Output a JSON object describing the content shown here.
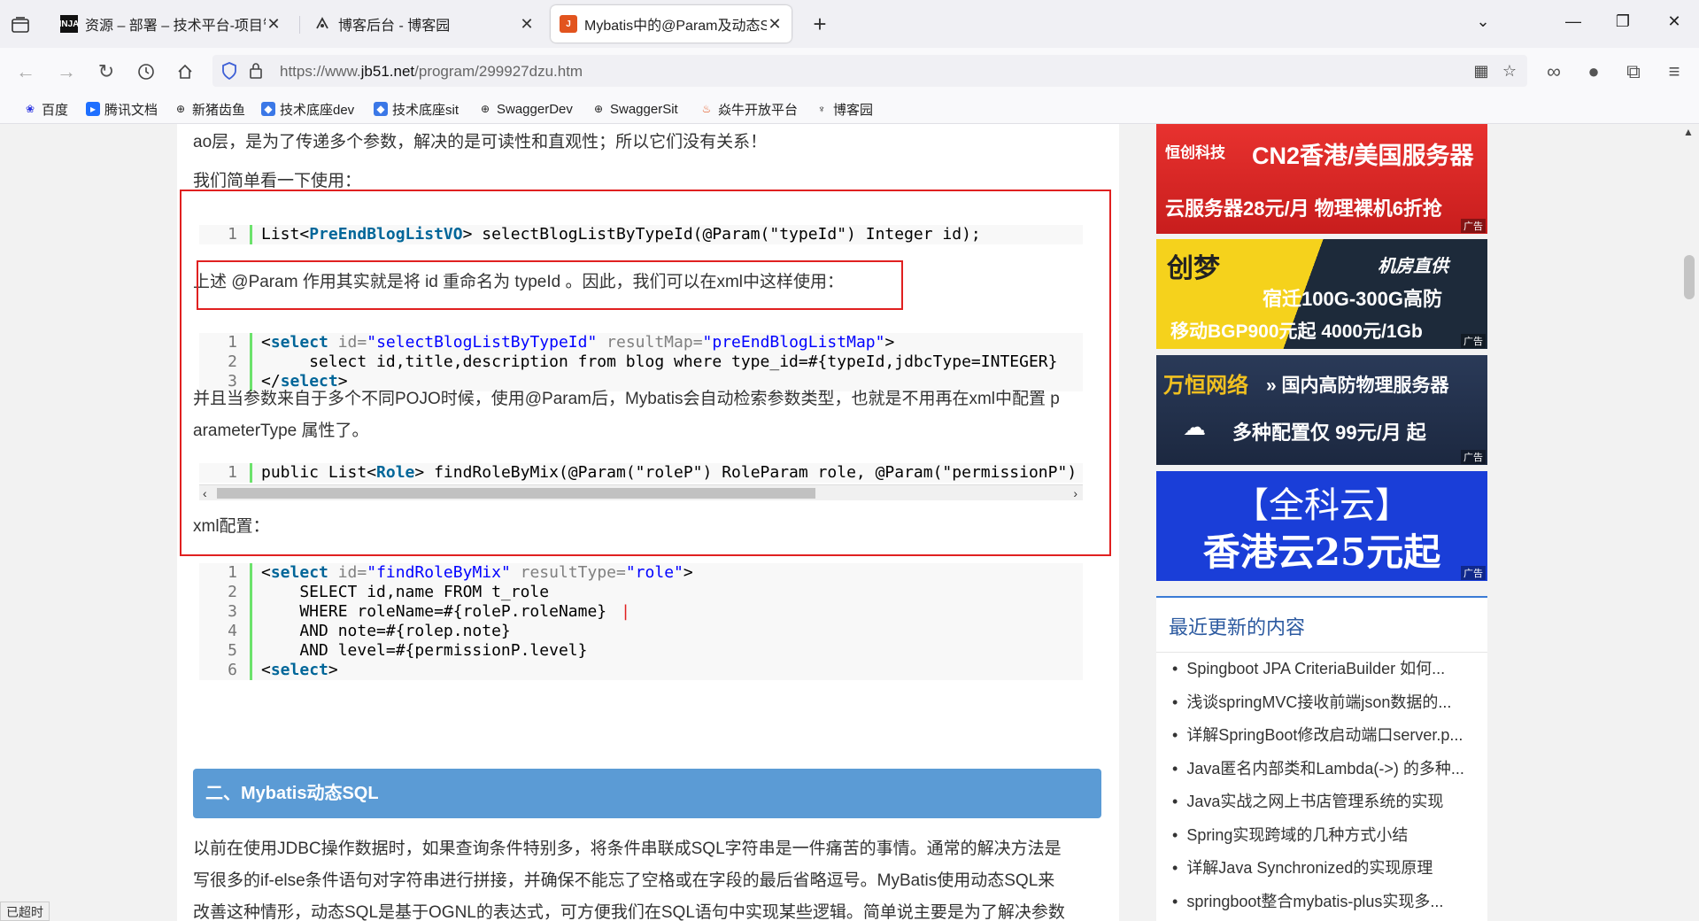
{
  "tabs": [
    {
      "label": "资源 – 部署 – 技术平台-项目管",
      "favicon": "INJA"
    },
    {
      "label": "博客后台 - 博客园",
      "favicon": "blog-icon"
    },
    {
      "label": "Mybatis中的@Param及动态SQ",
      "favicon": "jb51-icon"
    }
  ],
  "url": {
    "prefix": "https://www.",
    "host": "jb51.net",
    "path": "/program/299927dzu.htm"
  },
  "bookmarks": [
    "百度",
    "腾讯文档",
    "新猪齿鱼",
    "技术底座dev",
    "技术底座sit",
    "SwaggerDev",
    "SwaggerSit",
    "焱牛开放平台",
    "博客园"
  ],
  "article": {
    "p1": "ao层，是为了传递多个参数，解决的是可读性和直观性；所以它们没有关系！",
    "p2": "我们简单看一下使用：",
    "p3": "上述 @Param 作用其实就是将 id 重命名为 typeId 。因此，我们可以在xml中这样使用：",
    "p4a": "并且当参数来自于多个不同POJO时候，使用@Param后，Mybatis会自动检索参数类型，也就是不用再在xml中配置 p",
    "p4b": "arameterType 属性了。",
    "p5": "xml配置：",
    "section_title": "二、Mybatis动态SQL",
    "p6a": "以前在使用JDBC操作数据时，如果查询条件特别多，将条件串联成SQL字符串是一件痛苦的事情。通常的解决方法是",
    "p6b": "写很多的if-else条件语句对字符串进行拼接，并确保不能忘了空格或在字段的最后省略逗号。MyBatis使用动态SQL来",
    "p6c": "改善这种情形，动态SQL是基于OGNL的表达式，可方便我们在SQL语句中实现某些逻辑。简单说主要是为了解决参数"
  },
  "code1": {
    "n": "1",
    "t1": "List<",
    "t2": "PreEndBlogListVO",
    "t3": "> selectBlogListByTypeId(@Param(\"typeId\") Integer id);"
  },
  "code2": {
    "l1": {
      "n": "1",
      "a": "<",
      "b": "select",
      "c": " id=",
      "d": "\"selectBlogListByTypeId\"",
      "e": " resultMap=",
      "f": "\"preEndBlogListMap\"",
      "g": ">"
    },
    "l2": {
      "n": "2",
      "t": "     select id,title,description from blog where type_id=#{typeId,jdbcType=INTEGER}"
    },
    "l3": {
      "n": "3",
      "a": "</",
      "b": "select",
      "c": ">"
    }
  },
  "code3": {
    "n": "1",
    "t1": "public List<",
    "t2": "Role",
    "t3": "> findRoleByMix(@Param(\"roleP\") RoleParam role, @Param(\"permissionP\")"
  },
  "code4": {
    "l1": {
      "n": "1",
      "a": "<",
      "b": "select",
      "c": " id=",
      "d": "\"findRoleByMix\"",
      "e": " resultType=",
      "f": "\"role\"",
      "g": ">"
    },
    "l2": {
      "n": "2",
      "t": "    SELECT id,name FROM t_role"
    },
    "l3": {
      "n": "3",
      "t": "    WHERE roleName=#{roleP.roleName}"
    },
    "l4": {
      "n": "4",
      "t": "    AND note=#{rolep.note}"
    },
    "l5": {
      "n": "5",
      "t": "    AND level=#{permissionP.level}"
    },
    "l6": {
      "n": "6",
      "a": "<",
      "b": "select",
      "c": ">"
    }
  },
  "ads": [
    {
      "brand": "恒创科技",
      "line1": "CN2香港/美国服务器",
      "line2": "云服务器28元/月  物理裸机6折抢",
      "tag": "广告"
    },
    {
      "brand": "创梦",
      "line0": "机房直供",
      "line1": "宿迁100G-300G高防",
      "line2": "移动BGP900元起 4000元/1Gb",
      "tag": "广告"
    },
    {
      "brand": "万恒网络",
      "line1": "» 国内高防物理服务器",
      "line2": "多种配置仅 99元/月 起",
      "tag": "广告"
    },
    {
      "line1": "【全科云】",
      "line2": "香港云25元起",
      "tag": "广告"
    }
  ],
  "recent": {
    "title": "最近更新的内容",
    "items": [
      "Spingboot JPA CriteriaBuilder 如何...",
      "浅谈springMVC接收前端json数据的...",
      "详解SpringBoot修改启动端口server.p...",
      "Java匿名内部类和Lambda(->) 的多种...",
      "Java实战之网上书店管理系统的实现",
      "Spring实现跨域的几种方式小结",
      "详解Java Synchronized的实现原理",
      "springboot整合mybatis-plus实现多..."
    ]
  },
  "status": "已超时",
  "colors": {
    "accent_red": "#e02020",
    "section_blue": "#5b9bd5",
    "link_blue": "#2c5aa0"
  }
}
